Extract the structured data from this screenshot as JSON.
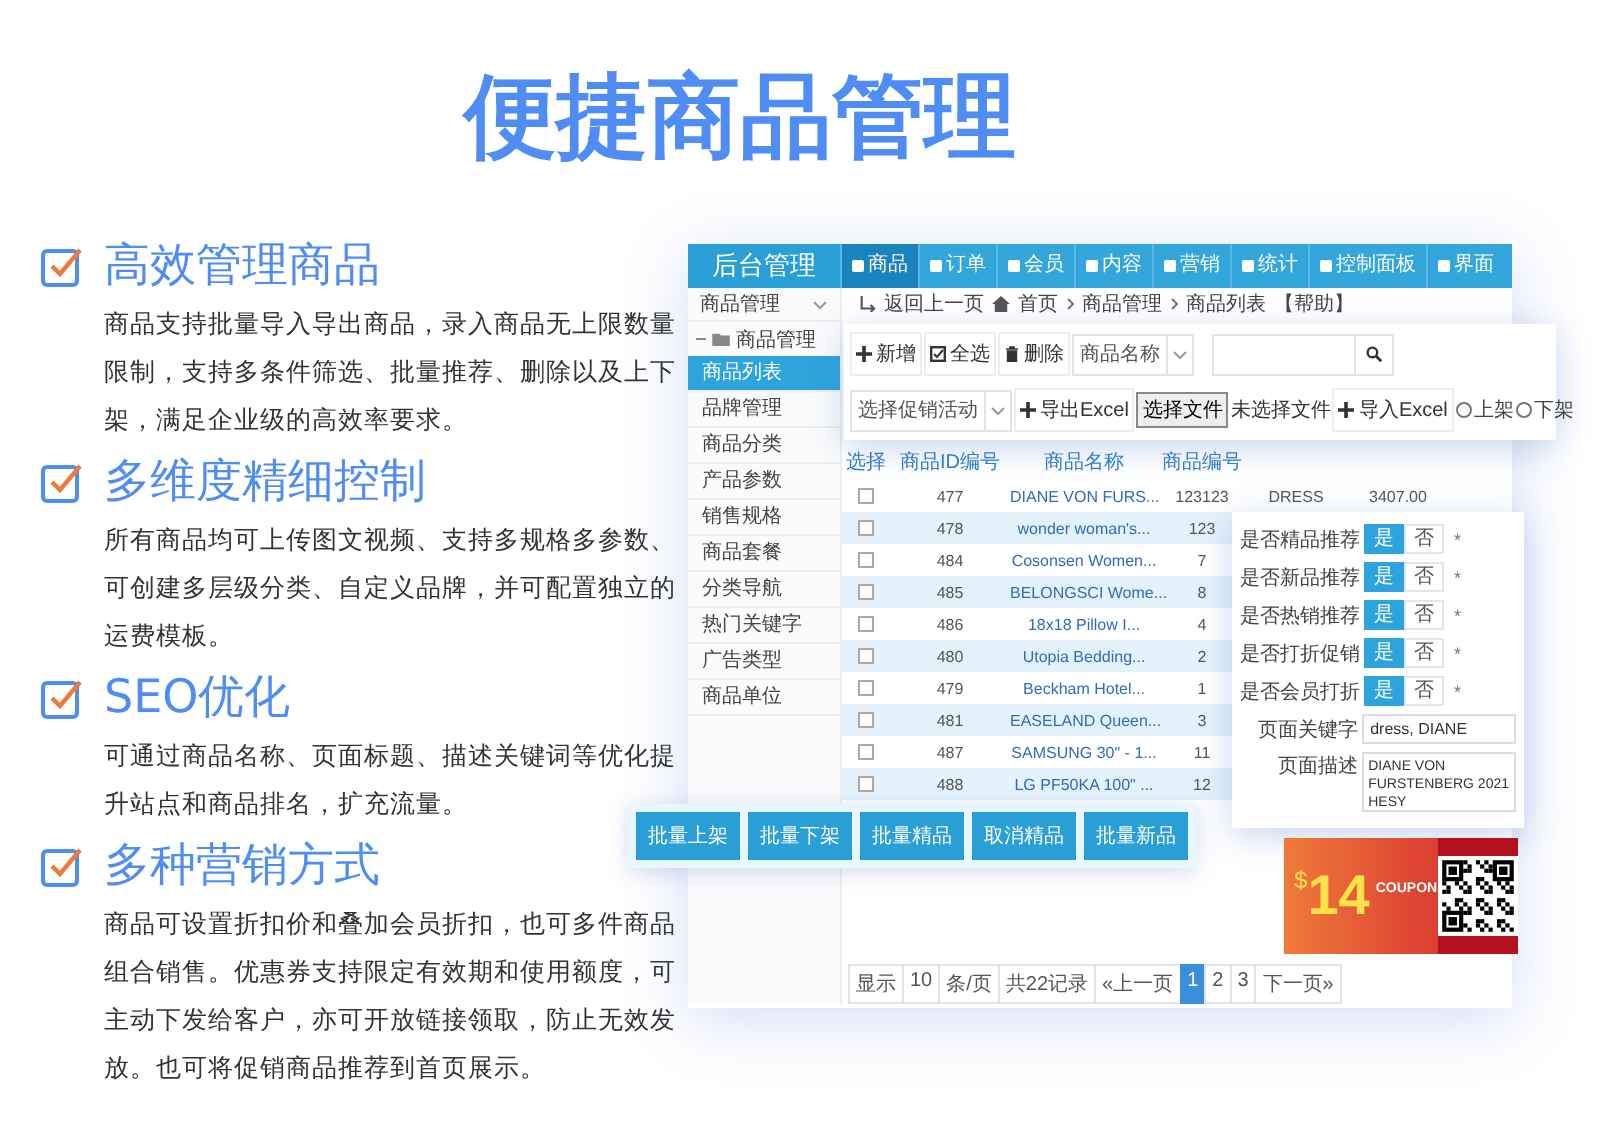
{
  "headline": "便捷商品管理",
  "features": [
    {
      "title": "高效管理商品",
      "text": "商品支持批量导入导出商品，录入商品无上限数量限制，支持多条件筛选、批量推荐、删除以及上下架，满足企业级的高效率要求。"
    },
    {
      "title": "多维度精细控制",
      "text": "所有商品均可上传图文视频、支持多规格多参数、可创建多层级分类、自定义品牌，并可配置独立的运费模板。"
    },
    {
      "title": "SEO优化",
      "text": "可通过商品名称、页面标题、描述关键词等优化提升站点和商品排名，扩充流量。"
    },
    {
      "title": "多种营销方式",
      "text": "商品可设置折扣价和叠加会员折扣，也可多件商品组合销售。优惠券支持限定有效期和使用额度，可主动下发给客户，亦可开放链接领取，防止无效发放。也可将促销商品推荐到首页展示。"
    }
  ],
  "admin": {
    "brand": "后台管理",
    "nav_tabs": [
      {
        "label": "商品",
        "selected": true
      },
      {
        "label": "订单",
        "selected": false
      },
      {
        "label": "会员",
        "selected": false
      },
      {
        "label": "内容",
        "selected": false
      },
      {
        "label": "营销",
        "selected": false
      },
      {
        "label": "统计",
        "selected": false
      },
      {
        "label": "控制面板",
        "selected": false
      },
      {
        "label": "界面",
        "selected": false
      }
    ],
    "sidebar": {
      "title": "商品管理",
      "expanded": true,
      "children": [
        {
          "label": "商品管理",
          "expanded": true,
          "children": [
            {
              "label": "商品列表",
              "selected": true
            },
            {
              "label": "品牌管理",
              "selected": false
            },
            {
              "label": "商品分类",
              "selected": false
            },
            {
              "label": "产品参数",
              "selected": false
            },
            {
              "label": "销售规格",
              "selected": false
            },
            {
              "label": "商品套餐",
              "selected": false
            },
            {
              "label": "分类导航",
              "selected": false
            },
            {
              "label": "热门关键字",
              "selected": false
            },
            {
              "label": "广告类型",
              "selected": false
            },
            {
              "label": "商品单位",
              "selected": false
            }
          ]
        }
      ]
    },
    "breadcrumb": {
      "back": "返回上一页",
      "path": [
        "首页",
        "商品管理",
        "商品列表"
      ],
      "help": "【帮助】"
    },
    "toolbar": {
      "buttons": [
        "新增",
        "全选",
        "删除"
      ],
      "field_select": "商品名称",
      "promo_select": "选择促销活动",
      "export": "导出Excel",
      "file_button": "选择文件",
      "file_status": "未选择文件",
      "import": "导入Excel",
      "radios": [
        {
          "label": "上架",
          "selected": false
        },
        {
          "label": "下架",
          "selected": false
        }
      ]
    },
    "table": {
      "select_header": "选择",
      "columns": [
        "商品ID编号",
        "商品名称",
        "商品编号"
      ],
      "rows": [
        {
          "checked": false,
          "cells": [
            "477",
            "DIANE VON FURS...",
            "123123",
            "DRESS",
            "3407.00"
          ]
        },
        {
          "checked": false,
          "cells": [
            "478",
            "wonder woman's...",
            "123"
          ]
        },
        {
          "checked": false,
          "cells": [
            "484",
            "Cosonsen Women...",
            "7"
          ]
        },
        {
          "checked": false,
          "cells": [
            "485",
            "BELONGSCI Wome...",
            "8"
          ]
        },
        {
          "checked": false,
          "cells": [
            "486",
            "18x18 Pillow I...",
            "4"
          ]
        },
        {
          "checked": false,
          "cells": [
            "480",
            "Utopia Bedding...",
            "2"
          ]
        },
        {
          "checked": false,
          "cells": [
            "479",
            "Beckham Hotel...",
            "1"
          ]
        },
        {
          "checked": false,
          "cells": [
            "481",
            "EASELAND Queen...",
            "3"
          ]
        },
        {
          "checked": false,
          "cells": [
            "487",
            "SAMSUNG 30\" - 1...",
            "11"
          ]
        },
        {
          "checked": false,
          "cells": [
            "488",
            "LG PF50KA 100\" ...",
            "12"
          ]
        }
      ]
    },
    "batch_buttons": [
      "批量上架",
      "批量下架",
      "批量精品",
      "取消精品",
      "批量新品"
    ],
    "pagination": {
      "show": "显示",
      "size": "10",
      "per_page": "条/页",
      "total": "共22记录",
      "prev": "«上一页",
      "pages": [
        {
          "label": "1",
          "selected": true
        },
        {
          "label": "2",
          "selected": false
        },
        {
          "label": "3",
          "selected": false
        }
      ],
      "next": "下一页»"
    },
    "settings": {
      "toggles": [
        {
          "label": "是否精品推荐",
          "options": [
            {
              "label": "是",
              "selected": true
            },
            {
              "label": "否",
              "selected": false
            }
          ],
          "required": "*"
        },
        {
          "label": "是否新品推荐",
          "options": [
            {
              "label": "是",
              "selected": true
            },
            {
              "label": "否",
              "selected": false
            }
          ],
          "required": "*"
        },
        {
          "label": "是否热销推荐",
          "options": [
            {
              "label": "是",
              "selected": true
            },
            {
              "label": "否",
              "selected": false
            }
          ],
          "required": "*"
        },
        {
          "label": "是否打折促销",
          "options": [
            {
              "label": "是",
              "selected": true
            },
            {
              "label": "否",
              "selected": false
            }
          ],
          "required": "*"
        },
        {
          "label": "是否会员打折",
          "options": [
            {
              "label": "是",
              "selected": true
            },
            {
              "label": "否",
              "selected": false
            }
          ],
          "required": "*"
        }
      ],
      "keywords": {
        "label": "页面关键字",
        "value": "dress, DIANE"
      },
      "description": {
        "label": "页面描述",
        "value": "DIANE VON FURSTENBERG 2021 HESY"
      }
    },
    "coupon": {
      "currency": "$",
      "amount": "14",
      "tag": "COUPON"
    }
  }
}
